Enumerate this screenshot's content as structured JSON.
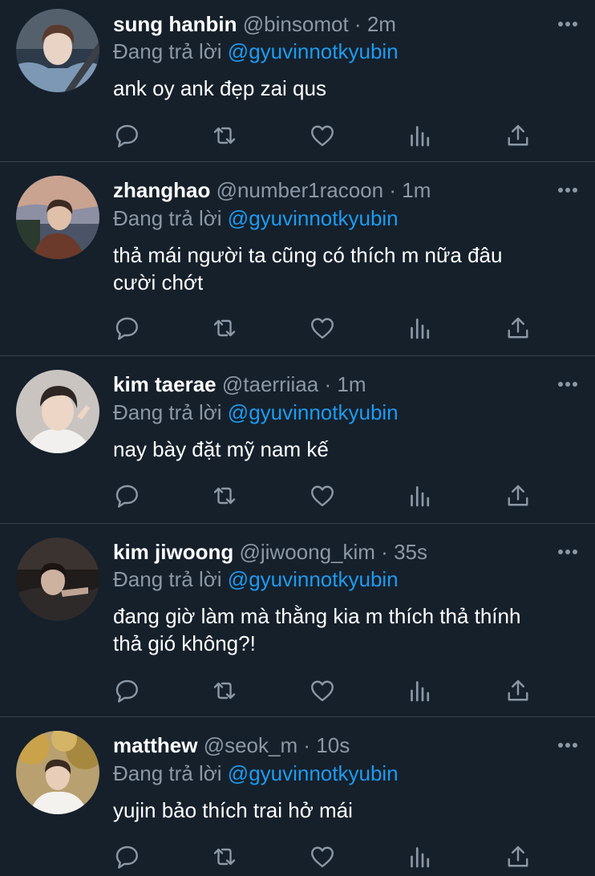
{
  "colors": {
    "background": "#15202b",
    "divider": "#38444d",
    "secondary_text": "#8b98a5",
    "mention": "#1d9bf0",
    "icon": "#8b98a5"
  },
  "icons": {
    "more": "more-horizontal-icon",
    "reply": "comment-icon",
    "retweet": "retweet-icon",
    "like": "heart-icon",
    "views": "analytics-bars-icon",
    "share": "share-upload-icon"
  },
  "tweets": [
    {
      "name": "sung hanbin",
      "handle": "@binsomot",
      "dot": "·",
      "time": "2m",
      "reply_prefix": "Đang trả lời",
      "reply_to": "@gyuvinnotkyubin",
      "text": "ank oy ank đẹp zai qus",
      "avatar_desc": "person in car with seatbelt"
    },
    {
      "name": "zhanghao",
      "handle": "@number1racoon",
      "dot": "·",
      "time": "1m",
      "reply_prefix": "Đang trả lời",
      "reply_to": "@gyuvinnotkyubin",
      "text": "thả mái người ta cũng có thích m nữa đâu\ncười chớt",
      "avatar_desc": "person outdoors at dusk"
    },
    {
      "name": "kim taerae",
      "handle": "@taerriiaa",
      "dot": "·",
      "time": "1m",
      "reply_prefix": "Đang trả lời",
      "reply_to": "@gyuvinnotkyubin",
      "text": "nay bày đặt mỹ nam kế",
      "avatar_desc": "person making v sign"
    },
    {
      "name": "kim jiwoong",
      "handle": "@jiwoong_kim",
      "dot": "·",
      "time": "35s",
      "reply_prefix": "Đang trả lời",
      "reply_to": "@gyuvinnotkyubin",
      "text": "đang giờ làm mà thằng kia m thích thả thính\nthả gió không?!",
      "avatar_desc": "person in dark room"
    },
    {
      "name": "matthew",
      "handle": "@seok_m",
      "dot": "·",
      "time": "10s",
      "reply_prefix": "Đang trả lời",
      "reply_to": "@gyuvinnotkyubin",
      "text": "yujin bảo thích trai hở mái",
      "avatar_desc": "person under autumn tree"
    }
  ]
}
